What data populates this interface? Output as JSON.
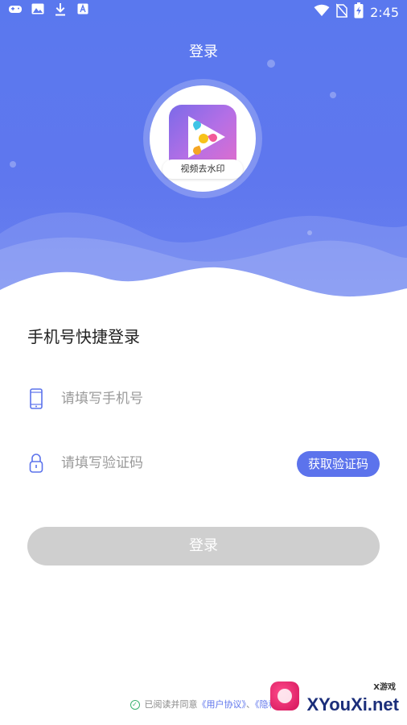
{
  "statusbar": {
    "time": "2:45"
  },
  "header": {
    "title": "登录"
  },
  "app": {
    "label": "视频去水印"
  },
  "login": {
    "section_title": "手机号快捷登录",
    "phone_placeholder": "请填写手机号",
    "code_placeholder": "请填写验证码",
    "get_code_label": "获取验证码",
    "submit_label": "登录"
  },
  "agreement": {
    "prefix": "已阅读并同意",
    "user_agreement": "《用户协议》",
    "separator": "、",
    "privacy": "《隐私"
  },
  "watermark": {
    "brand": "XYouXi.net",
    "small": "X游戏"
  },
  "colors": {
    "primary": "#5c73ec",
    "disabled": "#cfcfcf"
  },
  "icons": [
    "gamepad-icon",
    "image-icon",
    "download-icon",
    "text-a-icon",
    "wifi-icon",
    "no-sim-icon",
    "battery-charging-icon",
    "phone-icon",
    "lock-icon",
    "check-circle-icon"
  ]
}
